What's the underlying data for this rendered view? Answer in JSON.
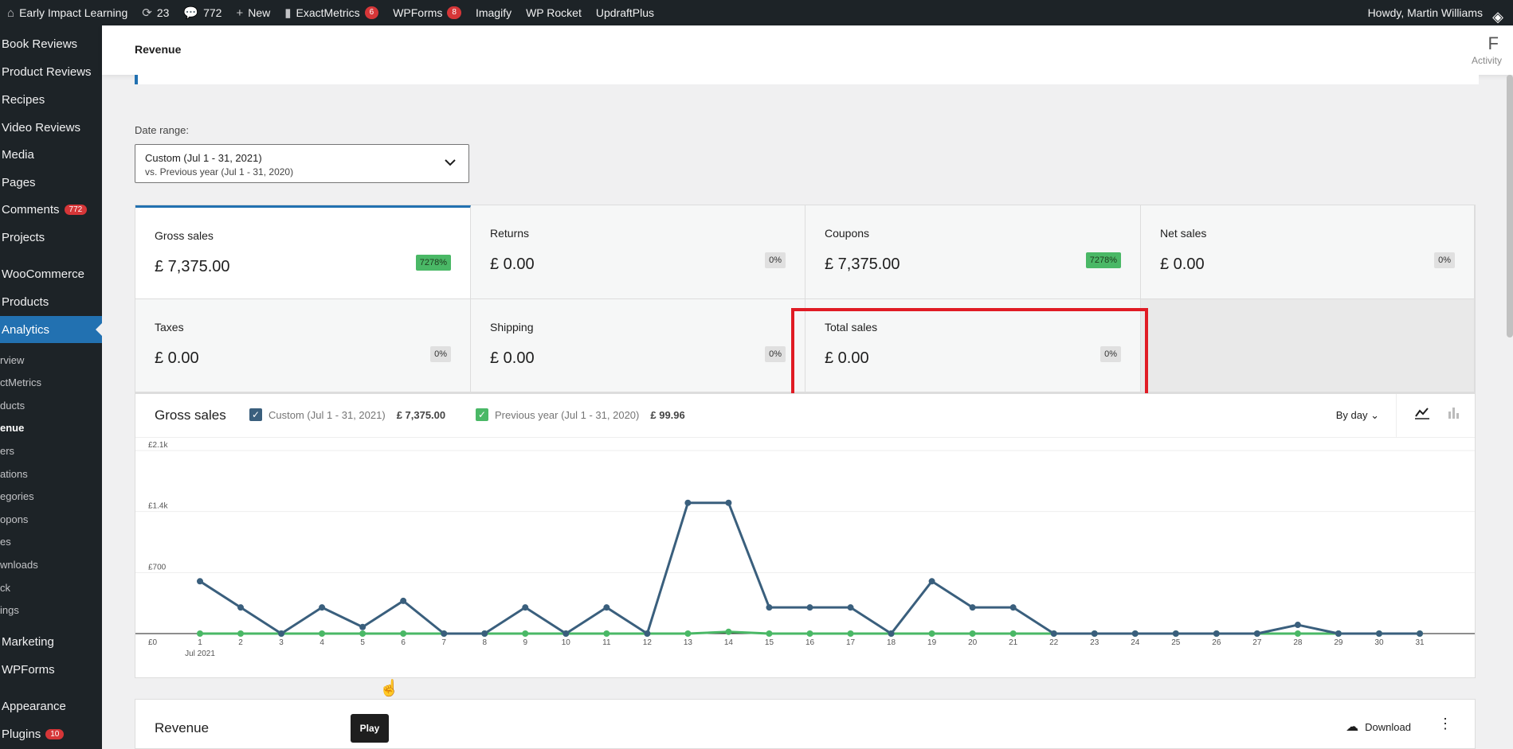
{
  "admin_bar": {
    "site_name": "Early Impact Learning",
    "updates_count": "23",
    "comments_count": "772",
    "new_label": "New",
    "exactmetrics_label": "ExactMetrics",
    "exactmetrics_badge": "6",
    "wpforms_label": "WPForms",
    "wpforms_badge": "8",
    "imagify_label": "Imagify",
    "wprocket_label": "WP Rocket",
    "updraft_label": "UpdraftPlus",
    "howdy": "Howdy, Martin Williams"
  },
  "sidebar": {
    "items": [
      {
        "label": "Book Reviews"
      },
      {
        "label": "Product Reviews"
      },
      {
        "label": "Recipes"
      },
      {
        "label": "Video Reviews"
      },
      {
        "label": "Media"
      },
      {
        "label": "Pages"
      },
      {
        "label": "Comments",
        "badge": "772"
      },
      {
        "label": "Projects"
      },
      {
        "label": "WooCommerce"
      },
      {
        "label": "Products"
      },
      {
        "label": "Analytics"
      },
      {
        "label": "Marketing"
      },
      {
        "label": "WPForms"
      },
      {
        "label": "Appearance"
      },
      {
        "label": "Plugins",
        "badge": "10"
      }
    ],
    "submenu": [
      "rview",
      "ctMetrics",
      "ducts",
      "enue",
      "ers",
      "ations",
      "egories",
      "opons",
      "es",
      "wnloads",
      "ck",
      "ings"
    ]
  },
  "header": {
    "title": "Revenue",
    "activity_letter": "F",
    "activity_label": "Activity"
  },
  "date_range": {
    "label": "Date range:",
    "line1": "Custom (Jul 1 - 31, 2021)",
    "line2": "vs. Previous year (Jul 1 - 31, 2020)"
  },
  "summary": [
    {
      "label": "Gross sales",
      "value": "£ 7,375.00",
      "delta": "7278%"
    },
    {
      "label": "Returns",
      "value": "£ 0.00",
      "delta": "0%"
    },
    {
      "label": "Coupons",
      "value": "£ 7,375.00",
      "delta": "7278%"
    },
    {
      "label": "Net sales",
      "value": "£ 0.00",
      "delta": "0%"
    },
    {
      "label": "Taxes",
      "value": "£ 0.00",
      "delta": "0%"
    },
    {
      "label": "Shipping",
      "value": "£ 0.00",
      "delta": "0%"
    },
    {
      "label": "Total sales",
      "value": "£ 0.00",
      "delta": "0%"
    }
  ],
  "chart_panel": {
    "title": "Gross sales",
    "legend1_label": "Custom (Jul 1 - 31, 2021)",
    "legend1_amount": "£ 7,375.00",
    "legend2_label": "Previous year (Jul 1 - 31, 2020)",
    "legend2_amount": "£ 99.96",
    "interval": "By day"
  },
  "chart_data": {
    "type": "line",
    "x": [
      1,
      2,
      3,
      4,
      5,
      6,
      7,
      8,
      9,
      10,
      11,
      12,
      13,
      14,
      15,
      16,
      17,
      18,
      19,
      20,
      21,
      22,
      23,
      24,
      25,
      26,
      27,
      28,
      29,
      30,
      31
    ],
    "x_sublabel": "Jul 2021",
    "yticks": [
      "£0",
      "£700",
      "£1.4k",
      "£2.1k"
    ],
    "ylim": [
      0,
      2100
    ],
    "series": [
      {
        "name": "Custom (Jul 1 - 31, 2021)",
        "color": "#3a5f7d",
        "values": [
          600,
          300,
          0,
          300,
          75,
          375,
          0,
          0,
          300,
          0,
          300,
          0,
          1500,
          1500,
          300,
          300,
          300,
          0,
          600,
          300,
          300,
          0,
          0,
          0,
          0,
          0,
          0,
          100,
          0,
          0,
          0
        ]
      },
      {
        "name": "Previous year (Jul 1 - 31, 2020)",
        "color": "#4ab866",
        "values": [
          0,
          0,
          0,
          0,
          0,
          0,
          0,
          0,
          0,
          0,
          0,
          0,
          0,
          20,
          0,
          0,
          0,
          0,
          0,
          0,
          0,
          0,
          0,
          0,
          0,
          0,
          0,
          0,
          0,
          0,
          0
        ]
      }
    ]
  },
  "revenue_panel": {
    "title": "Revenue",
    "play": "Play",
    "download": "Download"
  }
}
